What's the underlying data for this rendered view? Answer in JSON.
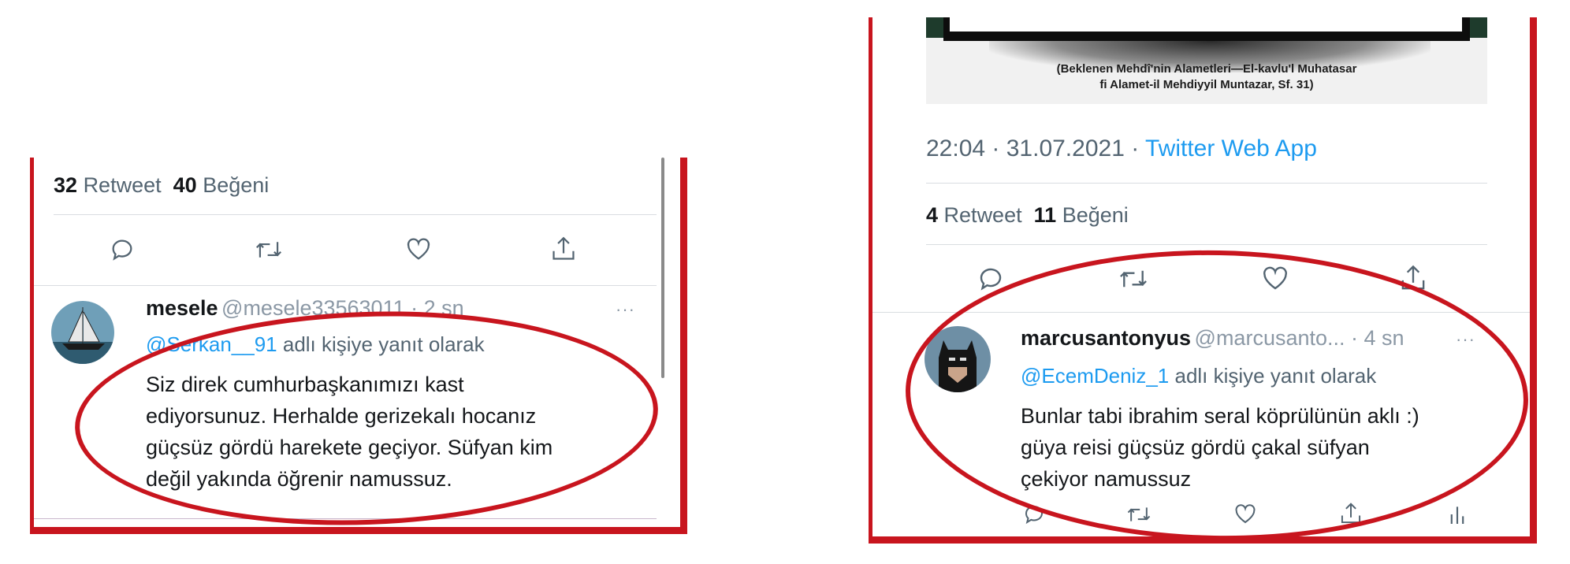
{
  "left_tweet": {
    "stats": {
      "retweet_count": "32",
      "retweet_label": "Retweet",
      "like_count": "40",
      "like_label": "Beğeni"
    },
    "reply": {
      "name": "mesele",
      "handle_time": "@mesele33563011 · 2 sn",
      "mention": "@Serkan__91",
      "reply_suffix": "adlı kişiye yanıt olarak",
      "lines": [
        "Siz direk cumhurbaşkanımızı kast",
        "ediyorsunuz. Herhalde gerizekalı hocanız",
        "güçsüz gördü harekete geçiyor. Süfyan kim",
        "değil yakında öğrenir namussuz."
      ]
    }
  },
  "right_tweet": {
    "image_caption": [
      "(Beklenen Mehdî'nin Alametleri—El-kavlu'l Muhatasar",
      "fi Alamet-il Mehdiyyil Muntazar, Sf. 31)"
    ],
    "timestamp": "22:04 · 31.07.2021 · ",
    "source": "Twitter Web App",
    "stats": {
      "retweet_count": "4",
      "retweet_label": "Retweet",
      "like_count": "11",
      "like_label": "Beğeni"
    },
    "reply": {
      "name": "marcusantonyus",
      "handle_time": "@marcusanto... · 4 sn",
      "mention": "@EcemDeniz_1",
      "reply_suffix": "adlı kişiye yanıt olarak",
      "lines": [
        "Bunlar tabi ibrahim seral köprülünün aklı :)",
        "güya reisi güçsüz gördü çakal süfyan",
        "çekiyor namussuz"
      ]
    }
  },
  "colors": {
    "highlight_red": "#c8151e",
    "link_blue": "#1d9bf0",
    "muted": "#536471"
  },
  "icons": [
    "reply-icon",
    "retweet-icon",
    "like-icon",
    "share-icon",
    "analytics-icon",
    "more-icon"
  ]
}
